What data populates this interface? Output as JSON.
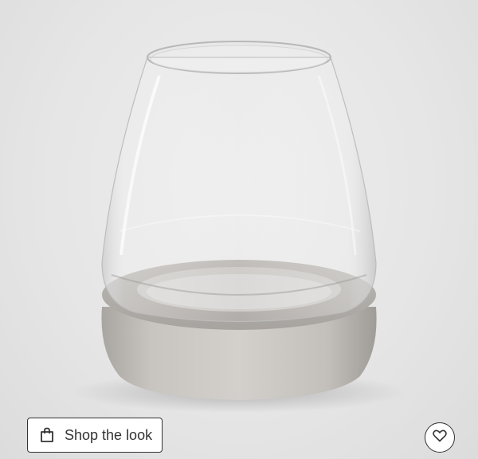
{
  "shop_button": {
    "label": "Shop the look",
    "icon": "shopping-bag-icon"
  },
  "favorite_button": {
    "icon": "heart-icon"
  },
  "colors": {
    "background": "#e4e4e4",
    "button_border": "#333333",
    "button_bg": "#ffffff"
  }
}
